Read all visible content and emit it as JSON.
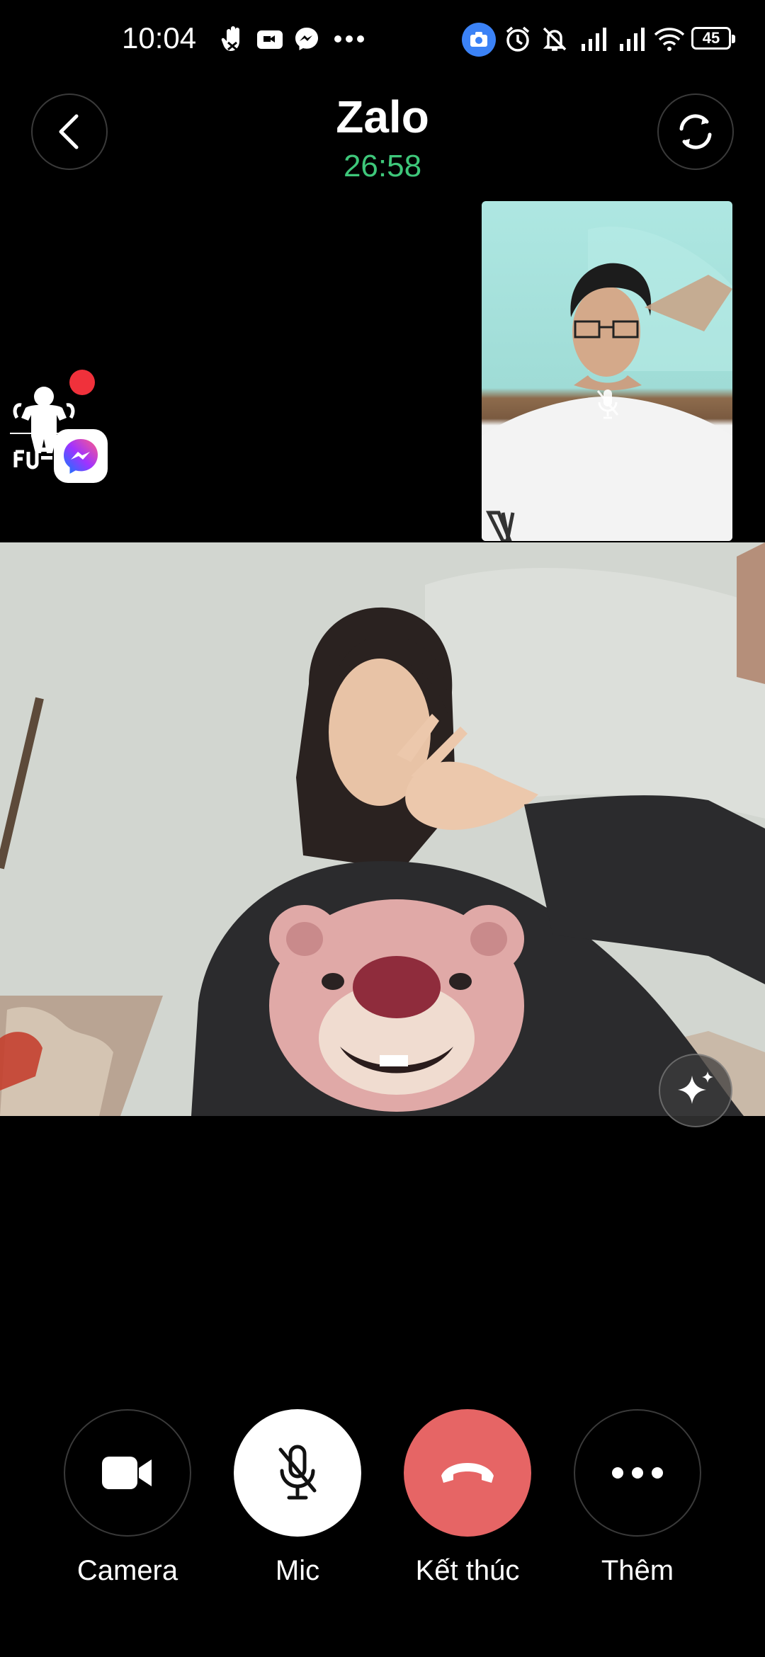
{
  "status_bar": {
    "time": "10:04",
    "battery": "45",
    "left_icons": [
      "hand-icon",
      "video-icon",
      "messenger-icon",
      "more-dots-icon"
    ],
    "right_icons": [
      "camera-badge-icon",
      "alarm-icon",
      "bell-off-icon",
      "signal-icon",
      "signal-icon",
      "wifi-icon"
    ]
  },
  "header": {
    "title": "Zalo",
    "timer": "26:58"
  },
  "colors": {
    "timer": "#3ec77a",
    "end_call": "#e66565",
    "background": "#000000"
  },
  "controls": {
    "camera_label": "Camera",
    "mic_label": "Mic",
    "end_label": "Kết thúc",
    "more_label": "Thêm"
  }
}
